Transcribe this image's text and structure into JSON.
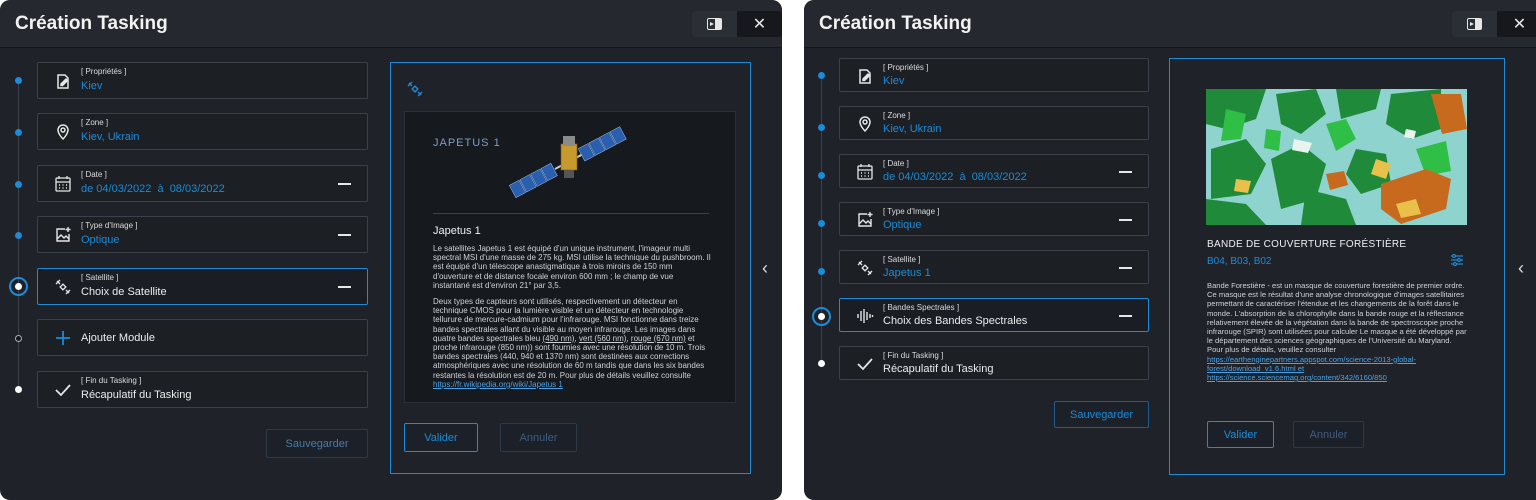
{
  "left": {
    "title": "Création Tasking",
    "steps": [
      {
        "label": "[ Propriétés ]",
        "value": "Kiev"
      },
      {
        "label": "[ Zone ]",
        "value": "Kiev, Ukrain"
      },
      {
        "label": "[ Date ]",
        "value": "de 04/03/2022  à  08/03/2022"
      },
      {
        "label": "[ Type d'Image ]",
        "value": "Optique"
      },
      {
        "label": "[ Satellite ]",
        "value": "Choix de Satellite"
      },
      {
        "label": "",
        "value": "Ajouter Module"
      },
      {
        "label": "[ Fin du Tasking ]",
        "value": "Récapulatif du Tasking"
      }
    ],
    "save_label": "Sauvegarder",
    "detail": {
      "art_title": "JAPETUS 1",
      "name": "Japetus 1",
      "para1": "Le satellites Japetus 1 est équipé d'un unique instrument, l'imageur multi spectral MSI d'une masse de 275 kg. MSI utilise la technique du pushbroom. Il est équipé d'un télescope anastigmatique à trois miroirs de 150 mm d'ouverture et de distance focale environ 600 mm ; le champ de vue instantané est d'environ 21° par 3,5.",
      "para2_a": "Deux types de capteurs sont utilisés, respectivement un détecteur en technique CMOS pour la lumière visible et un détecteur en technologie tellurure de mercure-cadmium pour l'infrarouge. MSI fonctionne dans treize bandes spectrales allant du visible au moyen infrarouge. Les images dans quatre bandes spectrales bleu ",
      "para2_b1": "(490 nm)",
      "para2_sep1": ", ",
      "para2_b2": "vert (560 nm)",
      "para2_sep2": ", ",
      "para2_b3": "rouge (670 nm)",
      "para2_c": " et proche infrarouge (850 nm)) sont fournies avec une résolution de 10 m. Trois bandes spectrales (440, 940 et 1370 nm) sont destinées aux corrections atmosphériques avec une résolution de 60 m tandis que dans les six bandes restantes la résolution est de 20 m. Pour plus de détails veuillez consulte ",
      "link": "https://fr.wikipedia.org/wiki/Japetus 1",
      "validate": "Valider",
      "cancel": "Annuler"
    }
  },
  "right": {
    "title": "Création Tasking",
    "steps": [
      {
        "label": "[ Propriétés ]",
        "value": "Kiev"
      },
      {
        "label": "[ Zone ]",
        "value": "Kiev, Ukrain"
      },
      {
        "label": "[ Date ]",
        "value": "de 04/03/2022  à  08/03/2022"
      },
      {
        "label": "[ Type d'Image ]",
        "value": "Optique"
      },
      {
        "label": "[ Satellite ]",
        "value": "Japetus 1"
      },
      {
        "label": "[ Bandes Spectrales ]",
        "value": "Choix des Bandes Spectrales"
      },
      {
        "label": "[ Fin du Tasking ]",
        "value": "Récapulatif du Tasking"
      }
    ],
    "save_label": "Sauvegarder",
    "detail": {
      "heading": "BANDE DE COUVERTURE FORÉSTIÈRE",
      "bands": "B04, B03, B02",
      "para": "Bande Forestière - est un masque de couverture forestière de premier ordre. Ce masque est le résultat d'une analyse chronologique d'images satellitaires permettant de caractériser l'étendue et les changements de la forêt dans le monde. L'absorption de la chlorophylle dans la bande rouge et la réflectance relativement élevée de la végétation dans la bande de spectroscopie proche infrarouge (SPIR) sont utilisées pour calculer Le masque a été développé par le département des sciences géographiques de l'Université du Maryland. Pour plus de détails, veuillez consulter",
      "link1": "https://earthenginepartners.appspot.com/science-2013-global-forest/download_v1.6.html",
      "link_mid": " et ",
      "link2": "https://science.sciencemag.org/content/342/6160/850",
      "validate": "Valider",
      "cancel": "Annuler"
    }
  }
}
